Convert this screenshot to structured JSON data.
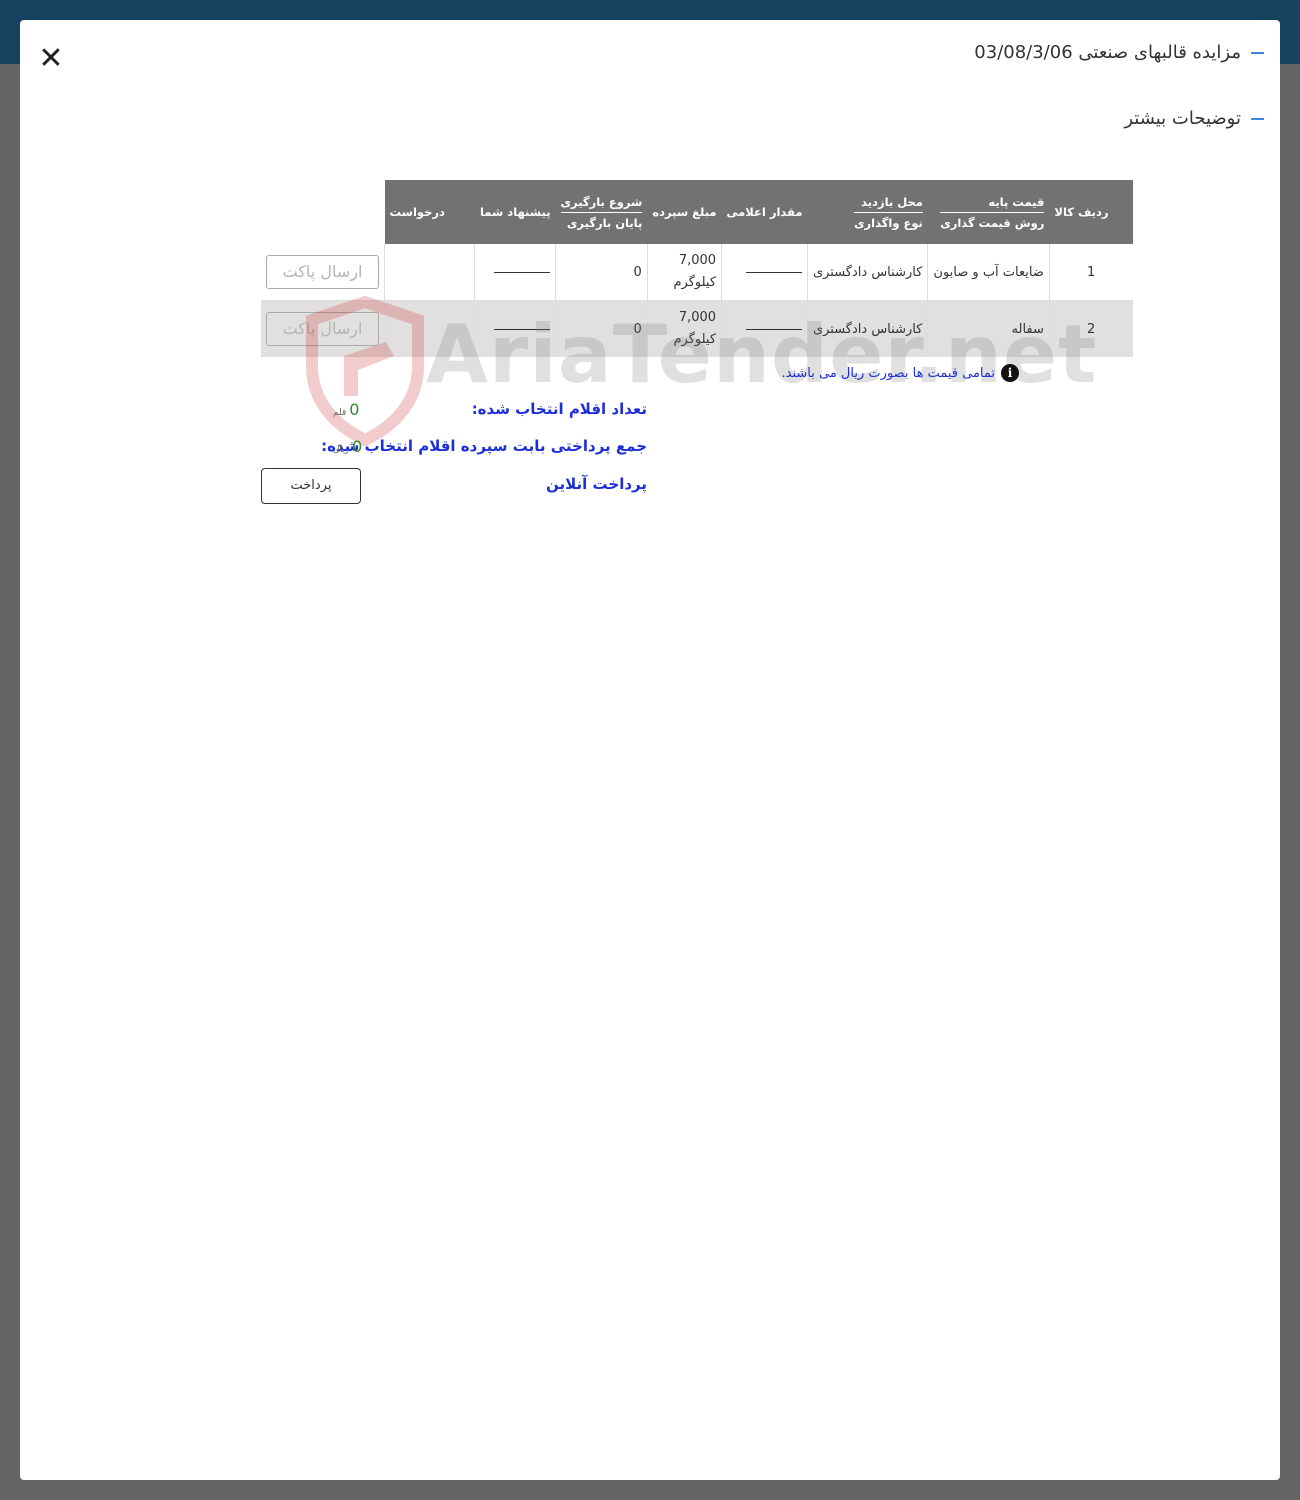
{
  "modal": {
    "title": "مزایده قالبهای صنعتی 03/08/3/06",
    "more_details": "توضیحات بیشتر"
  },
  "table": {
    "headers": {
      "row_item": "ردیف کالا",
      "base_price": "قیمت پایه",
      "pricing_method": "روش قیمت گذاری",
      "visit_location": "محل بازدید",
      "transfer_type": "نوع واگذاری",
      "declared_amount": "مقدار اعلامی",
      "deposit_amount": "مبلغ سپرده",
      "loading_start": "شروع بارگیری",
      "loading_end": "پایان بارگیری",
      "your_offer": "پیشنهاد شما",
      "request": "درخواست"
    },
    "rows": [
      {
        "index": "1",
        "item": "ضایعات آب و صابون",
        "pricing": "کارشناس دادگستری",
        "qty": "7,000",
        "unit": "کیلوگرم",
        "deposit": "0",
        "action": "ارسال پاکت"
      },
      {
        "index": "2",
        "item": "سفاله",
        "pricing": "کارشناس دادگستری",
        "qty": "7,000",
        "unit": "کیلوگرم",
        "deposit": "0",
        "action": "ارسال پاکت"
      }
    ]
  },
  "note": "تمامی قیمت ها بصورت ریال می باشند.",
  "summary": {
    "selected_label": "تعداد اقلام انتخاب شده:",
    "selected_value": "0",
    "selected_unit": "قلم",
    "payment_label": "جمع پرداختی بابت سپرده اقلام انتخاب شده:",
    "payment_value": "0",
    "payment_unit": "ریال",
    "online_label": "پرداخت آنلاین",
    "pay_button": "پرداخت"
  },
  "watermark": "AriaTender.net",
  "icons": {
    "close": "close-icon",
    "info": "info-icon"
  },
  "colors": {
    "accent": "#3b8ad9",
    "link_blue": "#1d2fd8",
    "header_gray": "#727272",
    "topbar": "#17425f"
  }
}
